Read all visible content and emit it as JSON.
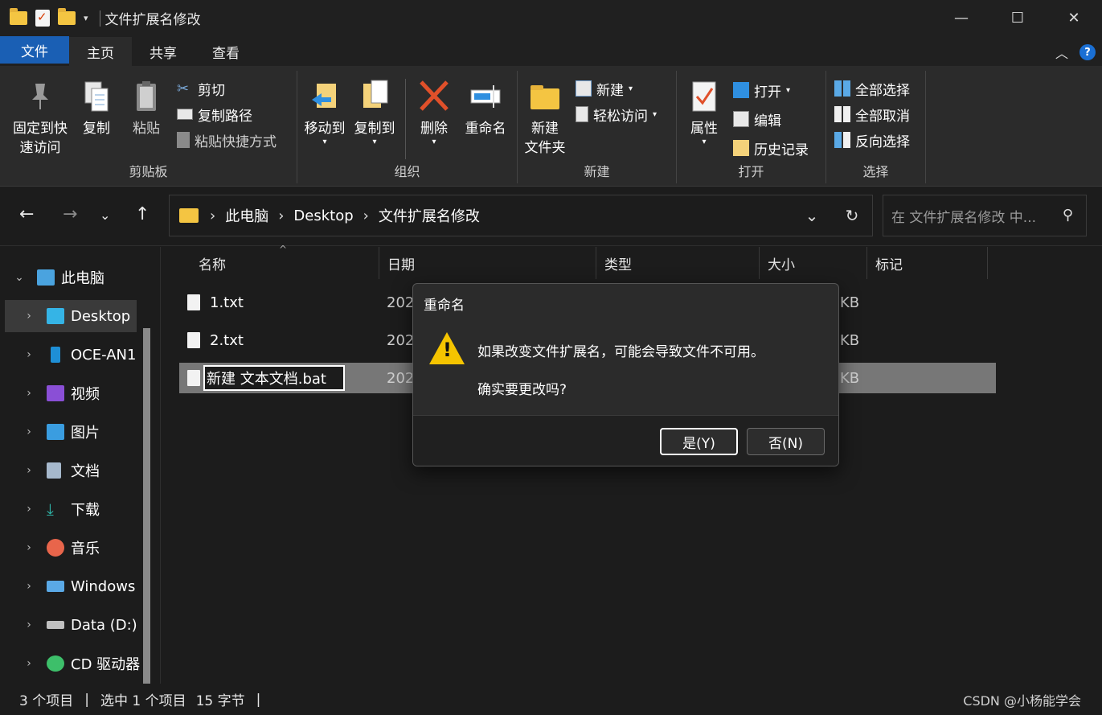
{
  "window": {
    "title": "文件扩展名修改",
    "minimize": "—",
    "maximize": "☐",
    "close": "✕"
  },
  "ribbon_tabs": [
    "文件",
    "主页",
    "共享",
    "查看"
  ],
  "ribbon": {
    "clipboard": {
      "label": "剪贴板",
      "pin_line1": "固定到快",
      "pin_line2": "速访问",
      "copy": "复制",
      "paste": "粘贴",
      "cut": "剪切",
      "copy_path": "复制路径",
      "paste_shortcut": "粘贴快捷方式"
    },
    "organize": {
      "label": "组织",
      "move_to": "移动到",
      "copy_to": "复制到",
      "delete": "删除",
      "rename": "重命名"
    },
    "new": {
      "label": "新建",
      "new_folder_line1": "新建",
      "new_folder_line2": "文件夹",
      "new_item": "新建",
      "easy_access": "轻松访问"
    },
    "open": {
      "label": "打开",
      "properties": "属性",
      "open": "打开",
      "edit": "编辑",
      "history": "历史记录"
    },
    "select": {
      "label": "选择",
      "select_all": "全部选择",
      "select_none": "全部取消",
      "invert": "反向选择"
    }
  },
  "address": {
    "crumbs": [
      "此电脑",
      "Desktop",
      "文件扩展名修改"
    ],
    "search_placeholder": "在 文件扩展名修改 中..."
  },
  "sidebar": {
    "items": [
      {
        "label": "此电脑",
        "color": "#4aa3df"
      },
      {
        "label": "Desktop",
        "color": "#35b4e6"
      },
      {
        "label": "OCE-AN1",
        "color": "#1e8fd6"
      },
      {
        "label": "视频",
        "color": "#8a4fd6"
      },
      {
        "label": "图片",
        "color": "#3a9de0"
      },
      {
        "label": "文档",
        "color": "#a6b8cc"
      },
      {
        "label": "下载",
        "color": "#2fb5a8"
      },
      {
        "label": "音乐",
        "color": "#e8654b"
      },
      {
        "label": "Windows",
        "color": "#5aa9e6"
      },
      {
        "label": "Data (D:)",
        "color": "#c0c0c0"
      },
      {
        "label": "CD 驱动器",
        "color": "#3dbf6a"
      }
    ]
  },
  "columns": [
    "名称",
    "日期",
    "类型",
    "大小",
    "标记"
  ],
  "files": [
    {
      "name": "1.txt",
      "date": "202",
      "size": "KB"
    },
    {
      "name": "2.txt",
      "date": "202",
      "size": "KB"
    },
    {
      "name": "新建 文本文档.bat",
      "date": "202",
      "size": "KB"
    }
  ],
  "status": {
    "count": "3 个项目",
    "selected": "选中 1 个项目",
    "bytes": "15 字节"
  },
  "watermark": "CSDN @小杨能学会",
  "dialog": {
    "title": "重命名",
    "message": "如果改变文件扩展名，可能会导致文件不可用。",
    "question": "确实要更改吗?",
    "yes": "是(Y)",
    "no": "否(N)"
  }
}
